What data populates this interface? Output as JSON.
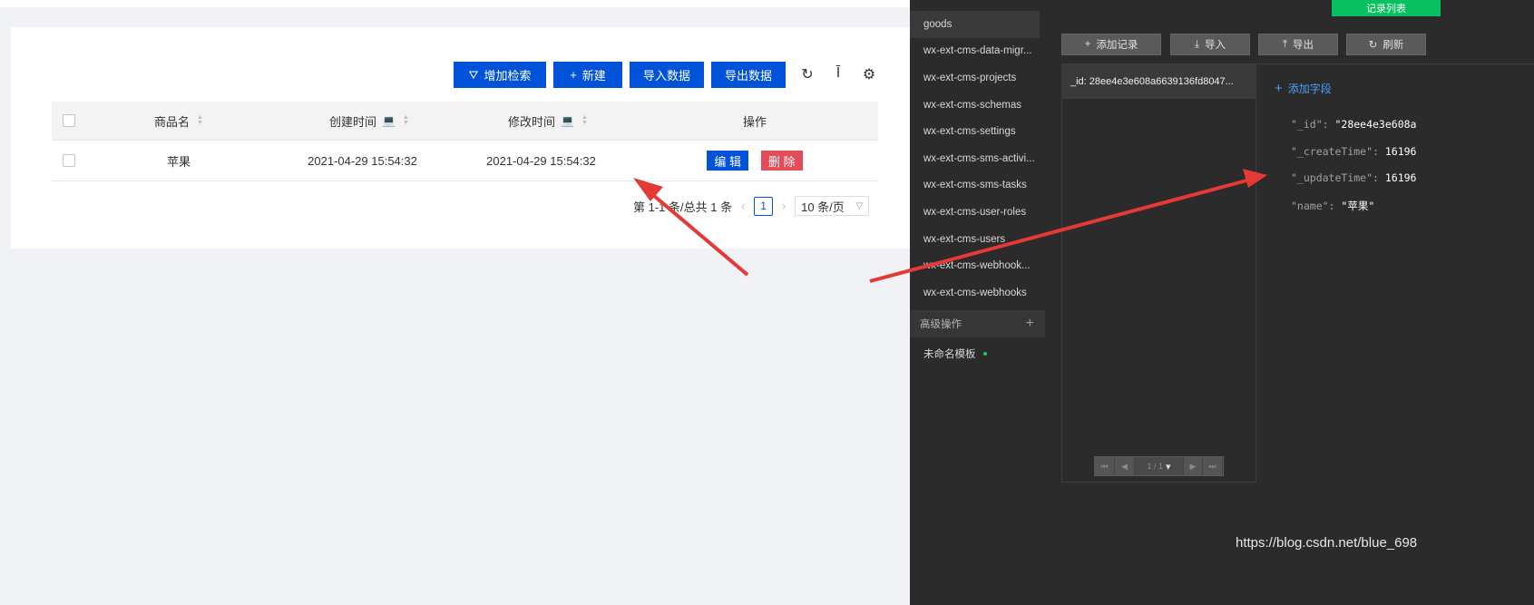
{
  "toolbar": {
    "add_filter": "增加检索",
    "new": "新建",
    "import": "导入数据",
    "export": "导出数据"
  },
  "table": {
    "columns": [
      "商品名",
      "创建时间",
      "修改时间",
      "操作"
    ],
    "rows": [
      {
        "name": "苹果",
        "created": "2021-04-29 15:54:32",
        "modified": "2021-04-29 15:54:32",
        "edit": "编 辑",
        "delete": "删 除"
      }
    ]
  },
  "pagination": {
    "summary": "第 1-1 条/总共 1 条",
    "current": "1",
    "page_size": "10 条/页"
  },
  "ide": {
    "collections": [
      "goods",
      "wx-ext-cms-data-migr...",
      "wx-ext-cms-projects",
      "wx-ext-cms-schemas",
      "wx-ext-cms-settings",
      "wx-ext-cms-sms-activi...",
      "wx-ext-cms-sms-tasks",
      "wx-ext-cms-user-roles",
      "wx-ext-cms-users",
      "wx-ext-cms-webhook...",
      "wx-ext-cms-webhooks"
    ],
    "advanced_title": "高级操作",
    "template_name": "未命名模板",
    "record_list_tab": "记录列表",
    "buttons": {
      "add_record": "添加记录",
      "import": "导入",
      "export": "导出",
      "refresh": "刷新"
    },
    "record_item": "_id: 28ee4e3e608a6639136fd8047...",
    "pagination": "1 / 1",
    "add_field": "添加字段",
    "fields": [
      {
        "key": "\"_id\": ",
        "value": "\"28ee4e3e608a"
      },
      {
        "key": "\"_createTime\": ",
        "value": "16196"
      },
      {
        "key": "\"_updateTime\": ",
        "value": "16196"
      },
      {
        "key": "\"name\": ",
        "value": "\"苹果\""
      }
    ]
  },
  "watermark": "https://blog.csdn.net/blue_698",
  "colors": {
    "primary": "#0052d9",
    "danger": "#e34d59",
    "ide_bg": "#2b2b2b",
    "accent_green": "#07c160",
    "arrow_red": "#e53935"
  }
}
